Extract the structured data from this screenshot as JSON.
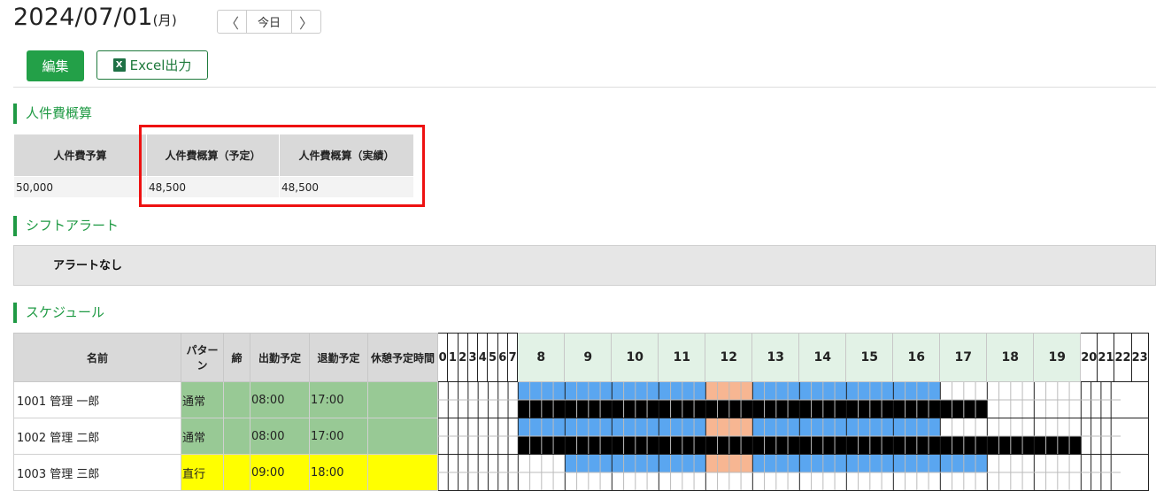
{
  "header": {
    "date": "2024/07/01",
    "day_of_week": "(月)",
    "prev_label": "〈",
    "today_label": "今日",
    "next_label": "〉"
  },
  "toolbar": {
    "edit_label": "編集",
    "excel_icon_text": "X",
    "excel_label": "Excel出力"
  },
  "labor_cost": {
    "section_title": "人件費概算",
    "headers": [
      "人件費予算",
      "人件費概算（予定）",
      "人件費概算（実績）"
    ],
    "values": [
      "50,000",
      "48,500",
      "48,500"
    ]
  },
  "shift_alert": {
    "section_title": "シフトアラート",
    "message": "アラートなし"
  },
  "schedule": {
    "section_title": "スケジュール",
    "columns": [
      "名前",
      "パターン",
      "締",
      "出勤予定",
      "退勤予定",
      "休憩予定時間"
    ],
    "hours": [
      "0",
      "1",
      "2",
      "3",
      "4",
      "5",
      "6",
      "7",
      "8",
      "9",
      "10",
      "11",
      "12",
      "13",
      "14",
      "15",
      "16",
      "17",
      "18",
      "19",
      "20",
      "21",
      "22",
      "23"
    ],
    "rows": [
      {
        "id_name": "1001 管理 一郎",
        "pattern": "通常",
        "close": "",
        "start": "08:00",
        "end": "17:00",
        "break": "",
        "row_color": "#98c995",
        "planned": [
          {
            "from": 8,
            "to": 12,
            "color": "#5aa6f0"
          },
          {
            "from": 12,
            "to": 13,
            "color": "#f7b692"
          },
          {
            "from": 13,
            "to": 17,
            "color": "#5aa6f0"
          }
        ],
        "actual": [
          {
            "from": 8,
            "to": 18,
            "color": "#000000"
          }
        ]
      },
      {
        "id_name": "1002 管理 二郎",
        "pattern": "通常",
        "close": "",
        "start": "08:00",
        "end": "17:00",
        "break": "",
        "row_color": "#98c995",
        "planned": [
          {
            "from": 8,
            "to": 12,
            "color": "#5aa6f0"
          },
          {
            "from": 12,
            "to": 13,
            "color": "#f7b692"
          },
          {
            "from": 13,
            "to": 17,
            "color": "#5aa6f0"
          }
        ],
        "actual": [
          {
            "from": 8,
            "to": 20,
            "color": "#000000"
          }
        ]
      },
      {
        "id_name": "1003 管理 三郎",
        "pattern": "直行",
        "close": "",
        "start": "09:00",
        "end": "18:00",
        "break": "",
        "row_color": "#ffff00",
        "planned": [
          {
            "from": 9,
            "to": 12,
            "color": "#5aa6f0"
          },
          {
            "from": 12,
            "to": 13,
            "color": "#f7b692"
          },
          {
            "from": 13,
            "to": 18,
            "color": "#5aa6f0"
          }
        ],
        "actual": []
      }
    ]
  }
}
